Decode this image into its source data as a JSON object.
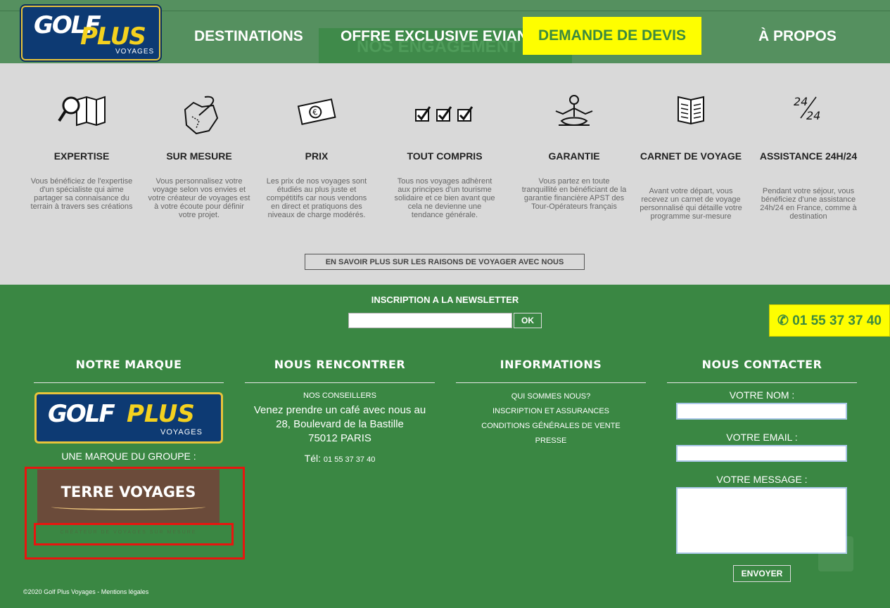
{
  "header": {
    "logo_main": "GOLF",
    "logo_accent": "PLUS",
    "logo_sub": "VOYAGES",
    "nav": [
      {
        "label": "DESTINATIONS"
      },
      {
        "label": "OFFRE EXCLUSIVE EVIAN"
      },
      {
        "label": "DEMANDE DE DEVIS"
      },
      {
        "label": "À PROPOS"
      }
    ],
    "ghost_heading": "NOS ENGAGEMENT"
  },
  "colors": {
    "header": "#55905f",
    "footer": "#3a8743",
    "highlight": "#fefe00",
    "panel": "#d9d9d9"
  },
  "features": [
    {
      "icon": "map-search-icon",
      "title": "EXPERTISE",
      "text": "Vous bénéficiez de l'expertise d'un spécialiste qui aime partager sa connaisance du terrain à travers ses créations"
    },
    {
      "icon": "quill-map-icon",
      "title": "SUR MESURE",
      "text": "Vous personnalisez votre voyage selon vos envies et votre créateur de voyages est à votre écoute pour définir votre projet."
    },
    {
      "icon": "banknote-icon",
      "title": "PRIX",
      "text": "Les prix de nos voyages sont étudiés au plus juste et compétitifs car nous vendons en direct et pratiquons des niveaux de charge modérés."
    },
    {
      "icon": "checkboxes-icon",
      "title": "TOUT COMPRIS",
      "text": "Tous nos voyages adhèrent aux principes d'un tourisme solidaire et ce bien avant que cela ne devienne une tendance générale."
    },
    {
      "icon": "meditation-icon",
      "title": "GARANTIE",
      "text": "Vous partez en toute tranquillité en bénéficiant de la garantie financière APST des Tour-Opérateurs français"
    },
    {
      "icon": "book-icon",
      "title": "CARNET DE VOYAGE",
      "text": "Avant votre départ, vous recevez un carnet de voyage personnalisé qui détaille votre programme sur-mesure"
    },
    {
      "icon": "24-24-icon",
      "title": "ASSISTANCE 24H/24",
      "text": "Pendant votre séjour, vous bénéficiez d'une assistance 24h/24 en France, comme à destination"
    }
  ],
  "icon_24_glyphs": {
    "top": "24",
    "bottom": "24"
  },
  "savoir_label": "EN SAVOIR PLUS SUR LES RAISONS DE VOYAGER AVEC NOUS",
  "newsletter": {
    "title": "INSCRIPTION A LA NEWSLETTER",
    "ok_label": "OK"
  },
  "phone": "✆ 01 55 37 37 40",
  "footer": {
    "col_brand": {
      "title": "NOTRE MARQUE",
      "groupe": "UNE MARQUE DU GROUPE :",
      "terre": "TERRE VOYAGES",
      "terre_sub": "CRÉATEUR DE VOYAGES SUR MESURE"
    },
    "col_meet": {
      "title": "NOUS RENCONTRER",
      "conseillers": "NOS CONSEILLERS",
      "line1": "Venez prendre un café avec nous au",
      "line2": "28, Boulevard de la Bastille",
      "line3": "75012 PARIS",
      "tel_label": "Tél:",
      "tel": "01 55 37 37 40"
    },
    "col_info": {
      "title": "INFORMATIONS",
      "links": [
        "QUI SOMMES NOUS?",
        "INSCRIPTION ET ASSURANCES",
        "CONDITIONS GÉNÉRALES DE VENTE",
        "PRESSE"
      ]
    },
    "col_contact": {
      "title": "NOUS CONTACTER",
      "name_label": "VOTRE NOM :",
      "email_label": "VOTRE EMAIL :",
      "message_label": "VOTRE MESSAGE :",
      "send_label": "ENVOYER"
    },
    "copyright": "©2020 Golf Plus Voyages - Mentions légales"
  }
}
